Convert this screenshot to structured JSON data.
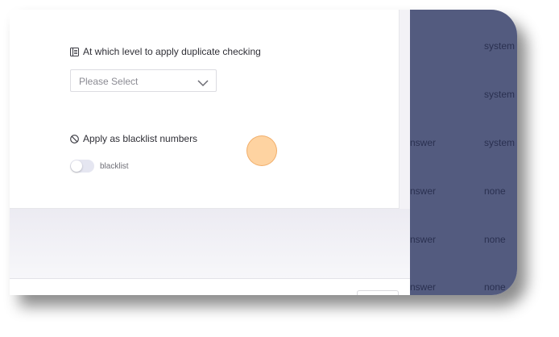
{
  "form": {
    "duplicate_level_label": "At which level to apply duplicate checking",
    "duplicate_level_select_placeholder": "Please Select",
    "blacklist_label": "Apply as blacklist numbers",
    "blacklist_toggle_label": "blacklist",
    "blacklist_toggle_on": false
  },
  "background_table": {
    "rows": [
      {
        "col1": "",
        "col2": "system"
      },
      {
        "col1": "",
        "col2": "system"
      },
      {
        "col1": "nswer",
        "col2": "system"
      },
      {
        "col1": "nswer",
        "col2": "none"
      },
      {
        "col1": "nswer",
        "col2": "none"
      },
      {
        "col1": "nswer",
        "col2": "none"
      }
    ]
  },
  "colors": {
    "overlay": "#535b7f",
    "highlight": "#fdc482",
    "toggle_track": "#e5e6f1"
  }
}
